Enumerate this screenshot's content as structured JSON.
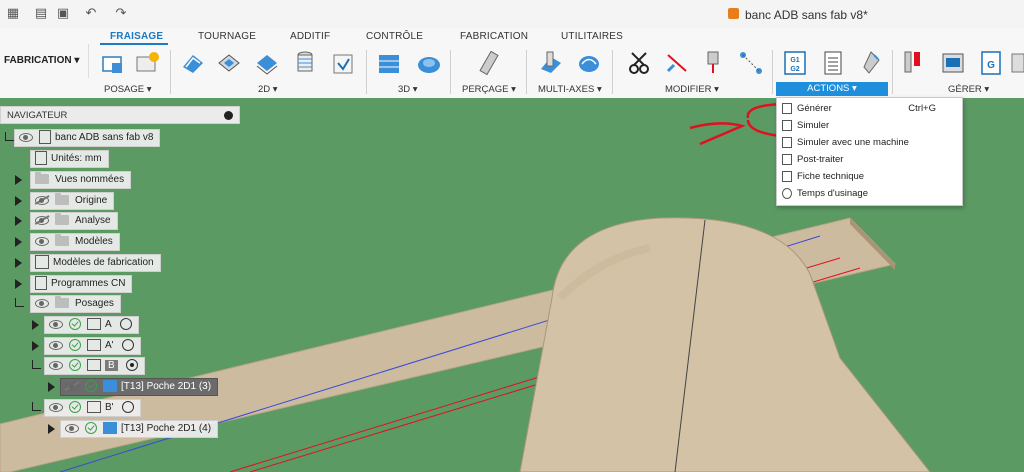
{
  "titlebar": {
    "doc_title": "banc ADB sans fab v8*",
    "icons": [
      "file-icon",
      "save-icon",
      "undo-icon",
      "redo-icon"
    ]
  },
  "workspace": {
    "label": "FABRICATION"
  },
  "tabs": [
    {
      "label": "FRAISAGE",
      "active": true
    },
    {
      "label": "TOURNAGE"
    },
    {
      "label": "ADDITIF"
    },
    {
      "label": "CONTRÔLE"
    },
    {
      "label": "FABRICATION"
    },
    {
      "label": "UTILITAIRES"
    }
  ],
  "groups": {
    "posage": "POSAGE",
    "g2d": "2D",
    "g3d": "3D",
    "percage": "PERÇAGE",
    "multiaxes": "MULTI-AXES",
    "modifier": "MODIFIER",
    "actions": "ACTIONS",
    "gerer": "GÉRER"
  },
  "navigator": {
    "title": "NAVIGATEUR",
    "root": "banc ADB sans fab v8",
    "units": "Unités: mm",
    "vues": "Vues nommées",
    "origine": "Origine",
    "analyse": "Analyse",
    "modeles": "Modèles",
    "modeles_fab": "Modèles de fabrication",
    "programmes": "Programmes CN",
    "posages": "Posages",
    "setup_a": "A",
    "setup_a2": "A'",
    "setup_b": "B",
    "op_b": "[T13] Poche 2D1 (3)",
    "setup_b2": "B'",
    "op_b2": "[T13] Poche 2D1 (4)"
  },
  "menu": {
    "items": [
      {
        "label": "Générer",
        "shortcut": "Ctrl+G"
      },
      {
        "label": "Simuler",
        "shortcut": ""
      },
      {
        "label": "Simuler avec une machine",
        "shortcut": ""
      },
      {
        "label": "Post-traiter",
        "shortcut": ""
      },
      {
        "label": "Fiche technique",
        "shortcut": ""
      },
      {
        "label": "Temps d'usinage",
        "shortcut": ""
      }
    ]
  },
  "colors": {
    "accent": "#1f8fdc",
    "viewport_green": "#5b9a63",
    "annotation_red": "#e01020"
  }
}
